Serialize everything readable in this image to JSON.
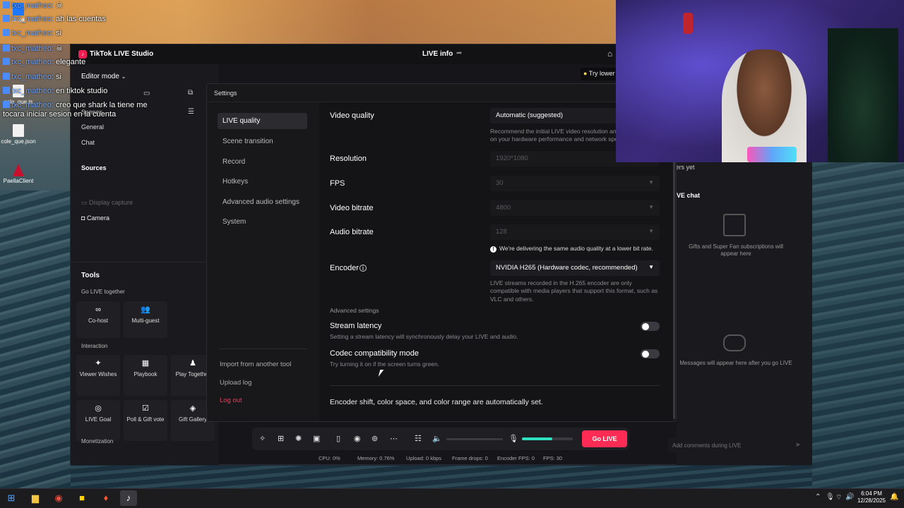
{
  "desktop": {
    "icons": [
      {
        "label": "tiktok"
      },
      {
        "label": "cole_que.js"
      },
      {
        "label": "cole_que.json"
      },
      {
        "label": "PaellaClient"
      }
    ]
  },
  "stream_chat": [
    {
      "user": "txc_matheo:",
      "msg": ""
    },
    {
      "user": "txc_matheo:",
      "msg": "ah las cuentas"
    },
    {
      "user": "txc_matheo:",
      "msg": "si"
    },
    {
      "user": "txc_matheo:",
      "msg": ""
    },
    {
      "user": "txc_matheo:",
      "msg": "elegante"
    },
    {
      "user": "txc_matheo:",
      "msg": "si"
    },
    {
      "user": "txc_matheo:",
      "msg": "en tiktok studio"
    },
    {
      "user": "txc_matheo:",
      "msg": "creo que shark la tiene me tocara iniciar sesion en la cuenta"
    }
  ],
  "app": {
    "title": "TikTok LIVE Studio",
    "center_title": "LIVE info",
    "try_lower": "Try lower",
    "editor_mode": "Editor mode",
    "scenes": "Scenes",
    "general": "General",
    "chat": "Chat",
    "sources_head": "Sources",
    "display_capture": "Display capture",
    "camera": "Camera",
    "tools_head": "Tools",
    "go_live_together": "Go LIVE together",
    "interaction": "Interaction",
    "monetization": "Monetization",
    "tools": {
      "cohost": "Co-host",
      "multiguest": "Multi-guest",
      "viewer_wishes": "Viewer Wishes",
      "playbook": "Playbook",
      "play_together": "Play Together",
      "live_goal": "LIVE Goal",
      "poll_gift": "Poll & Gift vote",
      "gift_gallery": "Gift Gallery"
    },
    "no_viewers": "No online viewers yet",
    "live_chat_head": "VE chat",
    "gifts_text": "Gifts and Super Fan subscriptions will appear here",
    "msgs_text": "Messages will appear here after you go LIVE",
    "chat_placeholder": "Add comments during LIVE",
    "go_live": "Go LIVE",
    "mic_level": 0.6,
    "stats": {
      "cpu": "CPU: 0%",
      "memory": "Memory: 0.76%",
      "upload": "Upload: 0 kbps",
      "frame_drops": "Frame drops: 0",
      "encoder_fps": "Encoder FPS: 0",
      "fps": "FPS: 30"
    }
  },
  "settings": {
    "title": "Settings",
    "nav": [
      {
        "label": "LIVE quality",
        "active": true
      },
      {
        "label": "Scene transition"
      },
      {
        "label": "Record"
      },
      {
        "label": "Hotkeys"
      },
      {
        "label": "Advanced audio settings"
      },
      {
        "label": "System"
      }
    ],
    "import": "Import from another tool",
    "upload_log": "Upload log",
    "logout": "Log out",
    "video_quality_label": "Video quality",
    "video_quality_value": "Automatic (suggested)",
    "video_quality_hint": "Recommend the initial LIVE video resolution and bitrate based on your hardware performance and network speed.",
    "resolution_label": "Resolution",
    "resolution_value": "1920*1080",
    "fps_label": "FPS",
    "fps_value": "30",
    "video_bitrate_label": "Video bitrate",
    "video_bitrate_value": "4800",
    "audio_bitrate_label": "Audio bitrate",
    "audio_bitrate_value": "128",
    "audio_note": "We're delivering the same audio quality at a lower bit rate.",
    "encoder_label": "Encoder",
    "encoder_value": "NVIDIA H265 (Hardware codec, recommended)",
    "encoder_hint": "LIVE streams recorded in the H.265 encoder are only compatible with media players that support this format, such as VLC and others.",
    "advanced_head": "Advanced settings",
    "stream_latency_label": "Stream latency",
    "stream_latency_desc": "Setting a stream latency will synchronously delay your LIVE and audio.",
    "codec_label": "Codec compatibility mode",
    "codec_desc": "Try turning it on if the screen turns green.",
    "footer_note": "Encoder shift, color space, and color range are automatically set."
  },
  "taskbar": {
    "time": "6:04 PM",
    "date": "12/28/2025"
  }
}
